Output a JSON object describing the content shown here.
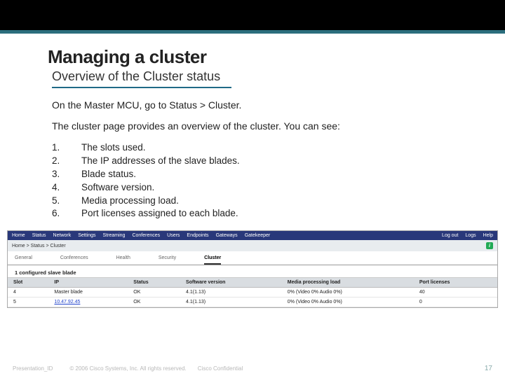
{
  "slide": {
    "title": "Managing a cluster",
    "subtitle": "Overview of the Cluster status",
    "para1": "On the Master MCU, go to Status > Cluster.",
    "para2": "The cluster page provides an overview of the cluster. You can see:",
    "items": [
      "The slots used.",
      "The IP addresses of the slave blades.",
      "Blade status.",
      "Software version.",
      "Media processing load.",
      "Port licenses assigned to each blade."
    ]
  },
  "ui": {
    "nav": [
      "Home",
      "Status",
      "Network",
      "Settings",
      "Streaming",
      "Conferences",
      "Users",
      "Endpoints",
      "Gateways",
      "Gatekeeper"
    ],
    "nav_right": [
      "Log out",
      "Logs",
      "Help"
    ],
    "breadcrumb": "Home > Status > Cluster",
    "tabs": [
      "General",
      "Conferences",
      "Health",
      "Security",
      "Cluster"
    ],
    "active_tab": "Cluster",
    "section_title": "1 configured slave blade",
    "columns": [
      "Slot",
      "IP",
      "Status",
      "Software version",
      "Media processing load",
      "Port licenses"
    ],
    "rows": [
      {
        "slot": "4",
        "ip": "Master blade",
        "ip_link": false,
        "status": "OK",
        "sw": "4.1(1.13)",
        "load": "0% (Video 0% Audio 0%)",
        "ports": "40"
      },
      {
        "slot": "5",
        "ip": "10.47.92.45",
        "ip_link": true,
        "status": "OK",
        "sw": "4.1(1.13)",
        "load": "0% (Video 0% Audio 0%)",
        "ports": "0"
      }
    ]
  },
  "footer": {
    "pid": "Presentation_ID",
    "copyright": "© 2006 Cisco Systems, Inc. All rights reserved.",
    "conf": "Cisco Confidential",
    "page": "17"
  }
}
